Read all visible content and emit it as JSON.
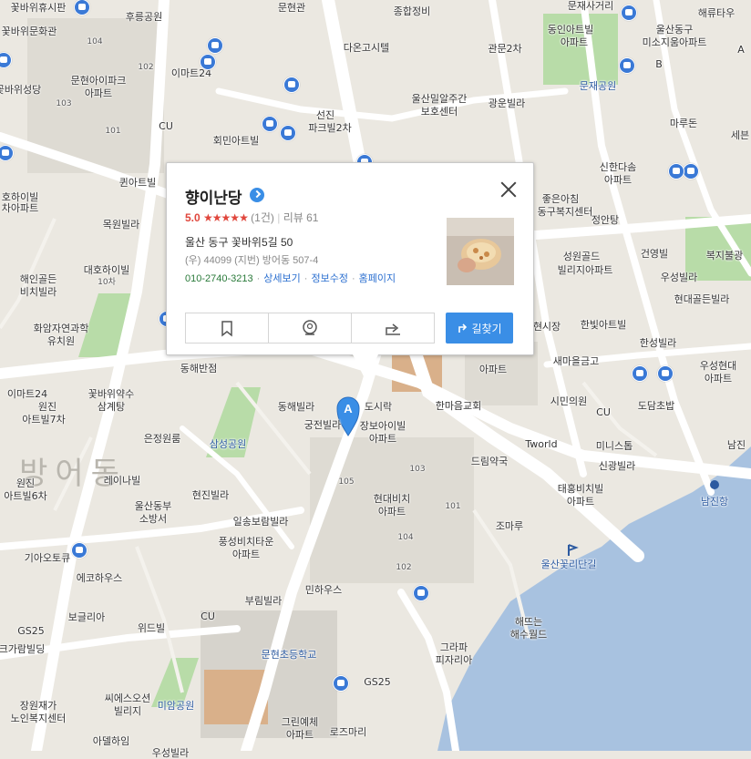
{
  "place": {
    "name": "향이난당",
    "rating": "5.0",
    "stars": "★★★★★",
    "count": "(1건)",
    "reviews": "리뷰 61",
    "address": "울산 동구 꽃바위5길 50",
    "jibun": "(우) 44099 (지번) 방어동 507-4",
    "phone": "010-2740-3213",
    "links": [
      "상세보기",
      "정보수정",
      "홈페이지"
    ],
    "route_label": "길찾기",
    "marker": "A"
  },
  "icons": {
    "title_arrow": "arrow-right-circle-icon",
    "close": "close-icon",
    "bookmark": "bookmark-icon",
    "streetview": "streetview-icon",
    "share": "share-icon",
    "route": "route-icon"
  },
  "colors": {
    "land": "#ebe8e1",
    "road": "#ffffff",
    "park": "#8fcc7e",
    "sea": "#a8c2e0",
    "school_ground": "#d9b08a",
    "accent": "#3a8ee6",
    "rating": "#e0463c"
  },
  "map": {
    "labels": [
      {
        "t": "꽃바위휴시판"
      },
      {
        "t": "후릉공원"
      },
      {
        "t": "문현관"
      },
      {
        "t": "종합정비"
      },
      {
        "t": "문재사거리"
      },
      {
        "t": "해류타우"
      },
      {
        "t": "꽃바위문화관"
      },
      {
        "t": "104"
      },
      {
        "t": "다온고시텔"
      },
      {
        "t": "관문2차"
      },
      {
        "t": "동인아트빌"
      },
      {
        "t": "아파트"
      },
      {
        "t": "울산동구"
      },
      {
        "t": "미소지움아파트"
      },
      {
        "t": "102"
      },
      {
        "t": "문현아이파크"
      },
      {
        "t": "아파트"
      },
      {
        "t": "이마트24"
      },
      {
        "t": "꽃바위성당"
      },
      {
        "t": "103"
      },
      {
        "t": "울산밀알주간"
      },
      {
        "t": "보호센터"
      },
      {
        "t": "광운빌라"
      },
      {
        "t": "문재공원"
      },
      {
        "t": "선진"
      },
      {
        "t": "파크빌2차"
      },
      {
        "t": "101"
      },
      {
        "t": "CU"
      },
      {
        "t": "회민아트빌"
      },
      {
        "t": "마루돈"
      },
      {
        "t": "세븐"
      },
      {
        "t": "퀸아트빌"
      },
      {
        "t": "신한다솜"
      },
      {
        "t": "아파트"
      },
      {
        "t": "호하이빌"
      },
      {
        "t": "차아파트"
      },
      {
        "t": "목원빌라"
      },
      {
        "t": "좋은아침"
      },
      {
        "t": "동구복지센터"
      },
      {
        "t": "정안탕"
      },
      {
        "t": "성원골드"
      },
      {
        "t": "빌리지아파트"
      },
      {
        "t": "건영빌"
      },
      {
        "t": "복지불광"
      },
      {
        "t": "해인골든"
      },
      {
        "t": "비치빌라"
      },
      {
        "t": "대호하이빌"
      },
      {
        "t": "10차"
      },
      {
        "t": "우성빌라"
      },
      {
        "t": "현대골든빌라"
      },
      {
        "t": "화암자연과학"
      },
      {
        "t": "유치원"
      },
      {
        "t": "현시장"
      },
      {
        "t": "한빛아트빌"
      },
      {
        "t": "한성빌라"
      },
      {
        "t": "새마을금고"
      },
      {
        "t": "동해반점"
      },
      {
        "t": "꽃바위약수"
      },
      {
        "t": "삼계탕"
      },
      {
        "t": "이마트24"
      },
      {
        "t": "원진"
      },
      {
        "t": "아트빌7차"
      },
      {
        "t": "동해빌라"
      },
      {
        "t": "도시락"
      },
      {
        "t": "한마음교회"
      },
      {
        "t": "아파트"
      },
      {
        "t": "시민의원"
      },
      {
        "t": "우성현대"
      },
      {
        "t": "아파트"
      },
      {
        "t": "도담초밥"
      },
      {
        "t": "궁전빌라"
      },
      {
        "t": "장보아이빌"
      },
      {
        "t": "아파트"
      },
      {
        "t": "CU"
      },
      {
        "t": "은정원룸"
      },
      {
        "t": "삼성공원"
      },
      {
        "t": "Tworld"
      },
      {
        "t": "미니스톱"
      },
      {
        "t": "남진"
      },
      {
        "t": "드림약국"
      },
      {
        "t": "신광빌라"
      },
      {
        "t": "방어동"
      },
      {
        "t": "원진"
      },
      {
        "t": "아트빌6차"
      },
      {
        "t": "레이나빌"
      },
      {
        "t": "현대비치"
      },
      {
        "t": "아파트"
      },
      {
        "t": "103"
      },
      {
        "t": "105"
      },
      {
        "t": "101"
      },
      {
        "t": "104"
      },
      {
        "t": "102"
      },
      {
        "t": "울산동부"
      },
      {
        "t": "소방서"
      },
      {
        "t": "현진빌라"
      },
      {
        "t": "태홍비치빌"
      },
      {
        "t": "아파트"
      },
      {
        "t": "남진항"
      },
      {
        "t": "일송보람빌라"
      },
      {
        "t": "조마루"
      },
      {
        "t": "기아오토큐"
      },
      {
        "t": "풍성비치타운"
      },
      {
        "t": "아파트"
      },
      {
        "t": "울산꽃리단길"
      },
      {
        "t": "에코하우스"
      },
      {
        "t": "민하우스"
      },
      {
        "t": "부림빌라"
      },
      {
        "t": "보글리아"
      },
      {
        "t": "CU"
      },
      {
        "t": "해뜨는"
      },
      {
        "t": "해수월드"
      },
      {
        "t": "GS25"
      },
      {
        "t": "위드빌"
      },
      {
        "t": "크가람빌딩"
      },
      {
        "t": "문현초등학교"
      },
      {
        "t": "그라파"
      },
      {
        "t": "피자리아"
      },
      {
        "t": "GS25"
      },
      {
        "t": "장원재가"
      },
      {
        "t": "노인복지센터"
      },
      {
        "t": "씨에스오션"
      },
      {
        "t": "빌리지"
      },
      {
        "t": "미암공원"
      },
      {
        "t": "그린예체"
      },
      {
        "t": "아파트"
      },
      {
        "t": "로즈마리"
      },
      {
        "t": "아델하임"
      },
      {
        "t": "우성빌라"
      },
      {
        "t": "A"
      },
      {
        "t": "B"
      }
    ]
  }
}
